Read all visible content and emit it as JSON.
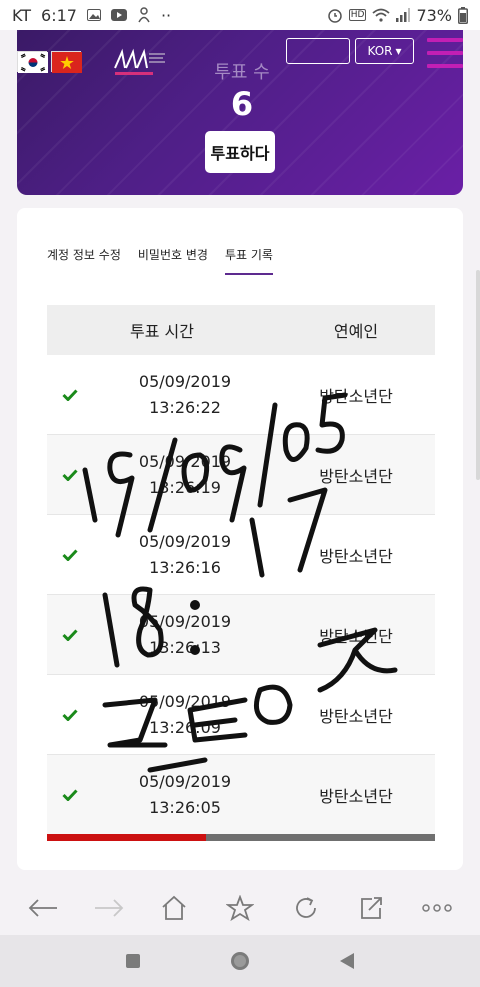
{
  "status_bar": {
    "carrier": "KT",
    "time": "6:17",
    "dots": "··",
    "hd": "HD",
    "battery": "73%"
  },
  "header": {
    "vote_count_label": "투표 수",
    "vote_count": "6",
    "vote_button": "투표하다",
    "language": "KOR",
    "language_caret": "▾"
  },
  "tabs": [
    {
      "label": "계정 정보 수정",
      "active": false
    },
    {
      "label": "비밀번호 변경",
      "active": false
    },
    {
      "label": "투표 기록",
      "active": true
    }
  ],
  "table": {
    "columns": [
      "투표 시간",
      "연예인"
    ],
    "rows": [
      {
        "date": "05/09/2019",
        "time": "13:26:22",
        "artist": "방탄소년단"
      },
      {
        "date": "05/09/2019",
        "time": "13:26:19",
        "artist": "방탄소년단"
      },
      {
        "date": "05/09/2019",
        "time": "13:26:16",
        "artist": "방탄소년단"
      },
      {
        "date": "05/09/2019",
        "time": "13:26:13",
        "artist": "방탄소년단"
      },
      {
        "date": "05/09/2019",
        "time": "13:26:09",
        "artist": "방탄소년단"
      },
      {
        "date": "05/09/2019",
        "time": "13:26:05",
        "artist": "방탄소년단"
      }
    ]
  },
  "progress": {
    "fraction": 0.41
  },
  "handwriting": {
    "line1": "19/09/05",
    "line2": "18:17",
    "line3": "ㄹㅌㅇㅈ"
  },
  "colors": {
    "header_purple": "#4e1f86",
    "menu_accent": "#c21fb4",
    "check_green": "#1a8a1a",
    "progress_red": "#cc1111",
    "progress_gray": "#6f6f6f"
  },
  "icons": {
    "status_left": [
      "gallery-icon",
      "youtube-icon",
      "bixby-icon"
    ],
    "status_right": [
      "alarm-icon",
      "hd-icon",
      "wifi-icon",
      "signal-icon",
      "battery-icon"
    ],
    "browser": [
      "back-icon",
      "forward-icon",
      "home-icon",
      "bookmark-icon",
      "reload-icon",
      "share-icon",
      "more-icon"
    ],
    "nav": [
      "recents-icon",
      "home-circle-icon",
      "back-triangle-icon"
    ]
  }
}
